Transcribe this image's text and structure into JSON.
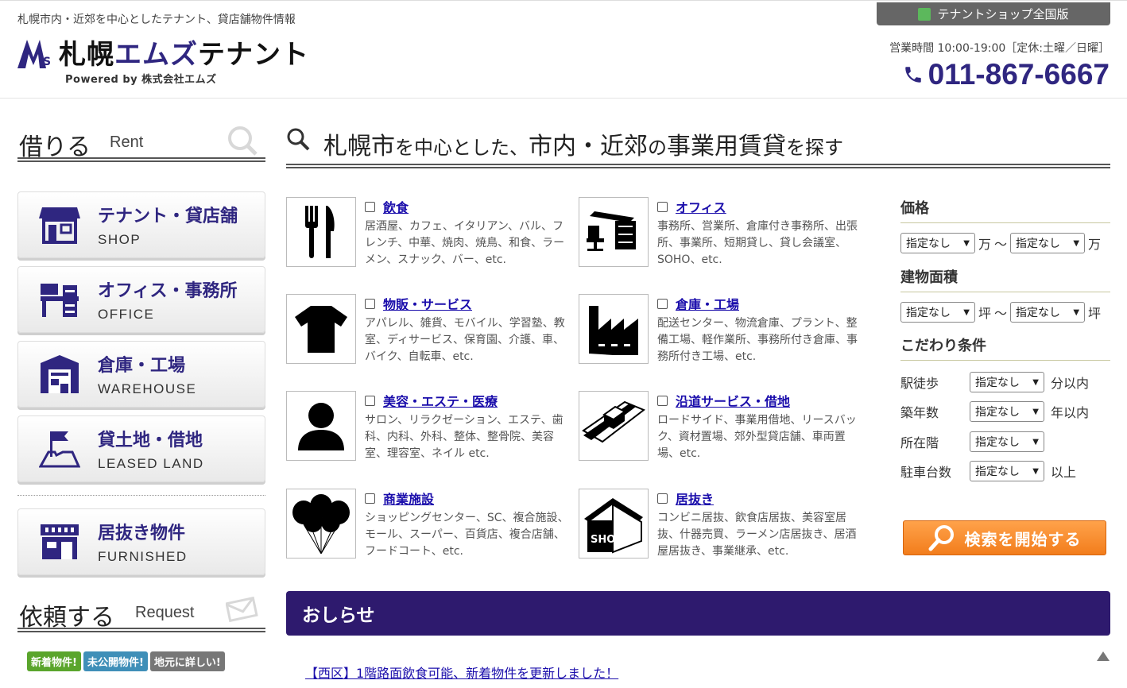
{
  "header": {
    "tagline": "札幌市内・近郊を中心としたテナント、貸店舗物件情報",
    "logo_part1": "札幌",
    "logo_part2": "エムズ",
    "logo_part3": "テナント",
    "powered_by": "Powered by 株式会社エムズ",
    "shop_tab": "テナントショップ全国版",
    "hours": "営業時間 10:00-19:00［定休:土曜／日曜］",
    "phone": "011-867-6667"
  },
  "sidebar": {
    "rent_heading": "借りる",
    "rent_heading_en": "Rent",
    "request_heading": "依頼する",
    "request_heading_en": "Request",
    "buttons": [
      {
        "label": "テナント・貸店舗",
        "sub": "SHOP",
        "icon": "shop-icon"
      },
      {
        "label": "オフィス・事務所",
        "sub": "OFFICE",
        "icon": "office-icon"
      },
      {
        "label": "倉庫・工場",
        "sub": "WAREHOUSE",
        "icon": "warehouse-icon"
      },
      {
        "label": "貸土地・借地",
        "sub": "LEASED LAND",
        "icon": "land-flag-icon"
      },
      {
        "label": "居抜き物件",
        "sub": "FURNISHED",
        "icon": "furnished-shop-icon"
      }
    ],
    "badges": [
      {
        "label": "新着物件!",
        "color": "#5aa52c"
      },
      {
        "label": "未公開物件!",
        "color": "#3f8fb8"
      },
      {
        "label": "地元に詳しい!",
        "color": "#777777"
      }
    ]
  },
  "main": {
    "title_a": "札幌市",
    "title_b": "を中心とした、",
    "title_c": "市内・近郊",
    "title_d": "の",
    "title_e": "事業用賃貸",
    "title_f": "を探す",
    "categories": [
      {
        "label": "飲食",
        "desc": "居酒屋、カフェ、イタリアン、バル、フレンチ、中華、焼肉、焼鳥、和食、ラーメン、スナック、バー、etc.",
        "icon": "fork-knife-icon"
      },
      {
        "label": "オフィス",
        "desc": "事務所、営業所、倉庫付き事務所、出張所、事業所、短期貸し、貸し会議室、SOHO、etc.",
        "icon": "office-desk-icon"
      },
      {
        "label": "物販・サービス",
        "desc": "アパレル、雑貨、モバイル、学習塾、教室、ディサービス、保育園、介護、車、バイク、自転車、etc.",
        "icon": "tshirt-icon"
      },
      {
        "label": "倉庫・工場",
        "desc": "配送センター、物流倉庫、プラント、整備工場、軽作業所、事務所付き倉庫、事務所付き工場、etc.",
        "icon": "factory-icon"
      },
      {
        "label": "美容・エステ・医療",
        "desc": "サロン、リラクゼーション、エステ、歯科、内科、外科、整体、整骨院、美容室、理容室、ネイル etc.",
        "icon": "person-icon"
      },
      {
        "label": "沿道サービス・借地",
        "desc": "ロードサイド、事業用借地、リースバック、資材置場、郊外型貸店舗、車両置場、etc.",
        "icon": "roadside-icon"
      },
      {
        "label": "商業施設",
        "desc": "ショッピングセンター、SC、複合施設、モール、スーパー、百貨店、複合店舗、フードコート、etc.",
        "icon": "balloons-icon"
      },
      {
        "label": "居抜き",
        "desc": "コンビニ居抜、飲食店居抜、美容室居抜、什器売買、ラーメン店居抜き、居酒屋居抜き、事業継承、etc.",
        "icon": "shop-house-icon"
      }
    ]
  },
  "filters": {
    "price_title": "価格",
    "area_title": "建物面積",
    "conditions_title": "こだわり条件",
    "default_option": "指定なし",
    "price_unit": "万",
    "area_unit": "坪",
    "range_sep": "〜",
    "conditions": [
      {
        "label": "駅徒歩",
        "unit": "分以内"
      },
      {
        "label": "築年数",
        "unit": "年以内"
      },
      {
        "label": "所在階",
        "unit": ""
      },
      {
        "label": "駐車台数",
        "unit": "以上"
      }
    ],
    "search_button": "検索を開始する"
  },
  "news": {
    "heading": "おしらせ",
    "items": [
      "【西区】1階路面飲食可能、新着物件を更新しました！"
    ]
  },
  "colors": {
    "brand_purple": "#2f2680",
    "news_bar": "#2e1a6e",
    "search_orange": "#f58a2b"
  }
}
